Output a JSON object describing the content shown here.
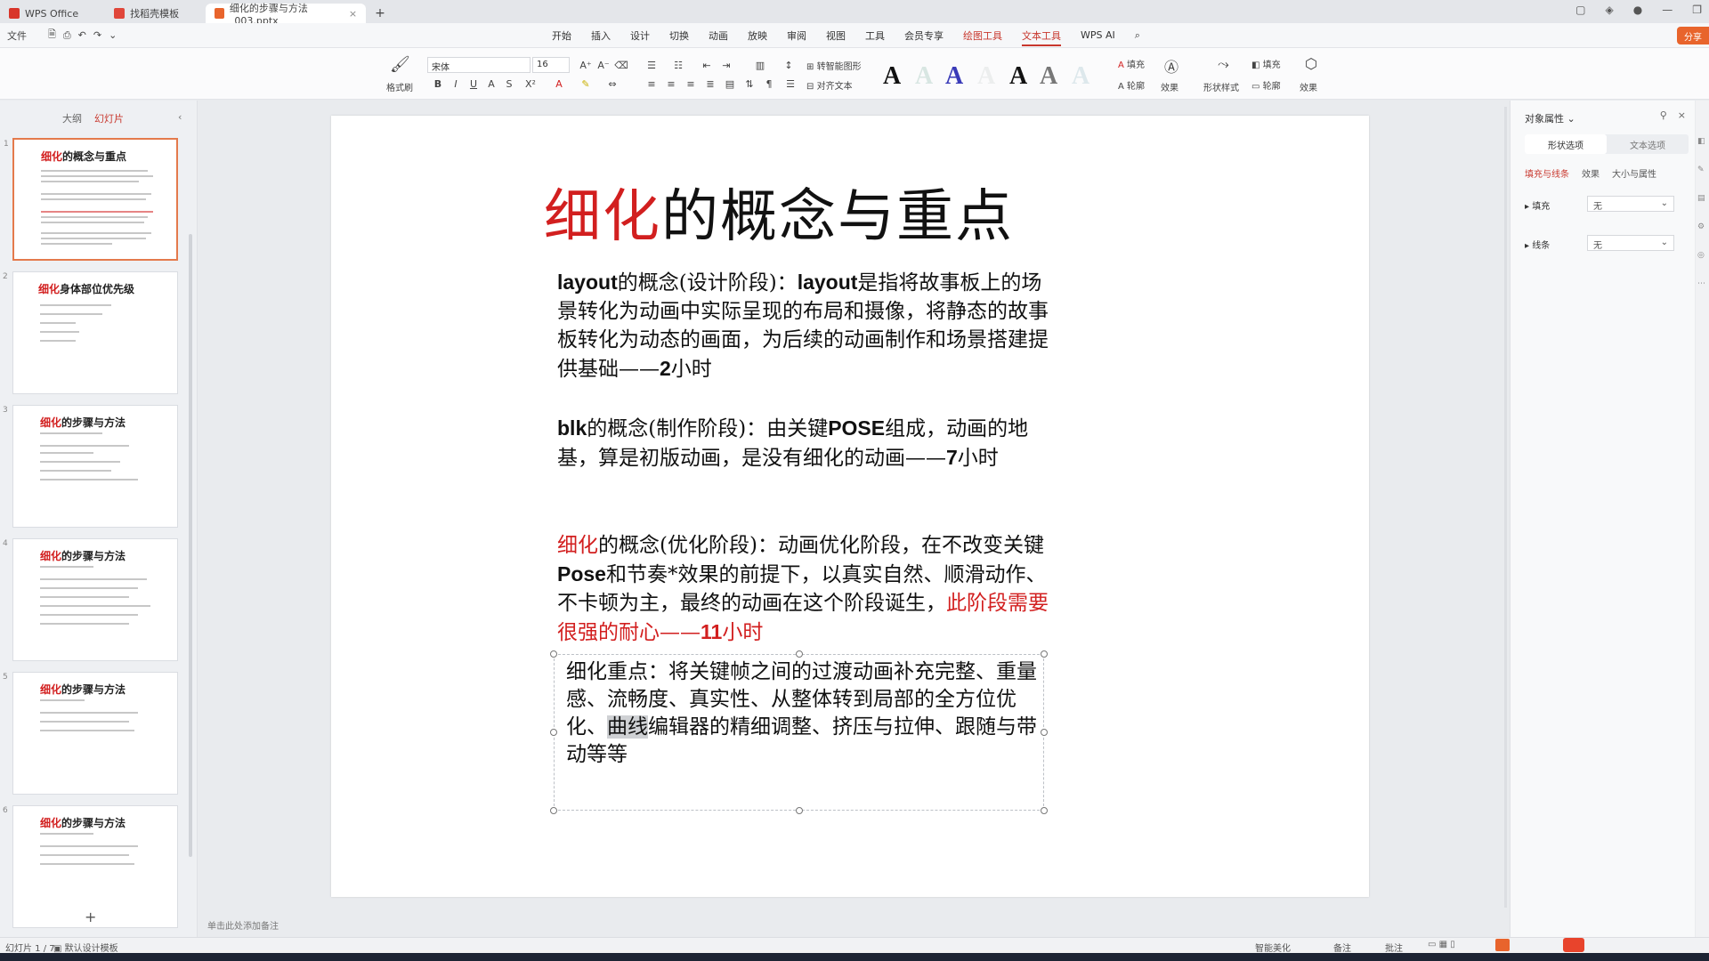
{
  "titlebar": {
    "tabs": [
      {
        "label": "WPS Office"
      },
      {
        "label": "找稻壳模板"
      },
      {
        "label": "细化的步骤与方法_003.pptx"
      }
    ],
    "new_tab": "+"
  },
  "menubar": {
    "file": "文件",
    "items": [
      "开始",
      "插入",
      "设计",
      "切换",
      "动画",
      "放映",
      "审阅",
      "视图",
      "工具",
      "会员专享",
      "绘图工具",
      "文本工具",
      "WPS AI"
    ],
    "share": "分享"
  },
  "ribbon": {
    "paste_label": "格式刷",
    "font_name": "宋体",
    "font_size": "16",
    "convert_label": "转智能图形",
    "align_label": "对齐文本",
    "fill_label": "填充",
    "outline_label": "轮廓",
    "effect_label": "效果",
    "shape_style": "形状样式",
    "fill2": "填充",
    "outline2": "轮廓",
    "effect2": "效果"
  },
  "left_panel": {
    "tabs": [
      "大纲",
      "幻灯片"
    ],
    "slides": [
      {
        "num": "1",
        "title_red": "细化",
        "title_rest": "的概念与重点"
      },
      {
        "num": "2",
        "title_red": "细化",
        "title_rest": "身体部位优先级"
      },
      {
        "num": "3",
        "title_red": "细化",
        "title_rest": "的步骤与方法"
      },
      {
        "num": "4",
        "title_red": "细化",
        "title_rest": "的步骤与方法"
      },
      {
        "num": "5",
        "title_red": "细化",
        "title_rest": "的步骤与方法"
      },
      {
        "num": "6",
        "title_red": "细化",
        "title_rest": "的步骤与方法"
      }
    ],
    "add": "+"
  },
  "slide": {
    "title_red": "细化",
    "title_rest": "的概念与重点",
    "p1": {
      "lead1": "layout",
      "lead2": "的概念(设计阶段)：",
      "lead3": "layout",
      "body": "是指将故事板上的场景转化为动画中实际呈现的布局和摄像，将静态的故事板转化为动态的画面，为后续的动画制作和场景搭建提供基础——",
      "num": "2",
      "unit": "小时"
    },
    "p2": {
      "lead1": "blk",
      "lead2": "的概念(制作阶段)：",
      "body1": "由关键",
      "pose": "POSE",
      "body2": "组成，动画的地基，算是初版动画，是没有细化的动画——",
      "num": "7",
      "unit": "小时"
    },
    "p3": {
      "lead_red": "细化",
      "lead2": "的概念(优化阶段)：",
      "body1": "动画优化阶段，在不改变关键",
      "pose": "Pose",
      "body2": "和节奏*效果的前提下，以真实自然、顺滑动作、不卡顿为主，最终的动画在这个阶段诞生，",
      "red_text": "此阶段需要很强的耐心——",
      "red_num": "11",
      "red_unit": "小时"
    },
    "p4": {
      "text1": "细化重点：将关键帧之间的过渡动画补充完整、重量感、流畅度、真实性、从整体转到局部的全方位优化、",
      "selected": "曲线",
      "text2": "编辑器的精细调整、挤压与拉伸、跟随与带动等等"
    }
  },
  "notes_placeholder": "单击此处添加备注",
  "right_panel": {
    "title": "对象属性",
    "tabs": [
      "形状选项",
      "文本选项"
    ],
    "subtabs": [
      "填充与线条",
      "效果",
      "大小与属性"
    ],
    "fill_label": "填充",
    "fill_value": "无",
    "line_label": "线条",
    "line_value": "无"
  },
  "status": {
    "slide_count": "幻灯片 1 / 7",
    "design": "默认设计模板",
    "smart": "智能美化",
    "notes": "备注",
    "comment": "批注"
  },
  "colors": {
    "accent": "#c8372d",
    "slide_red": "#d21f1f",
    "selection": "#e47a4c"
  }
}
